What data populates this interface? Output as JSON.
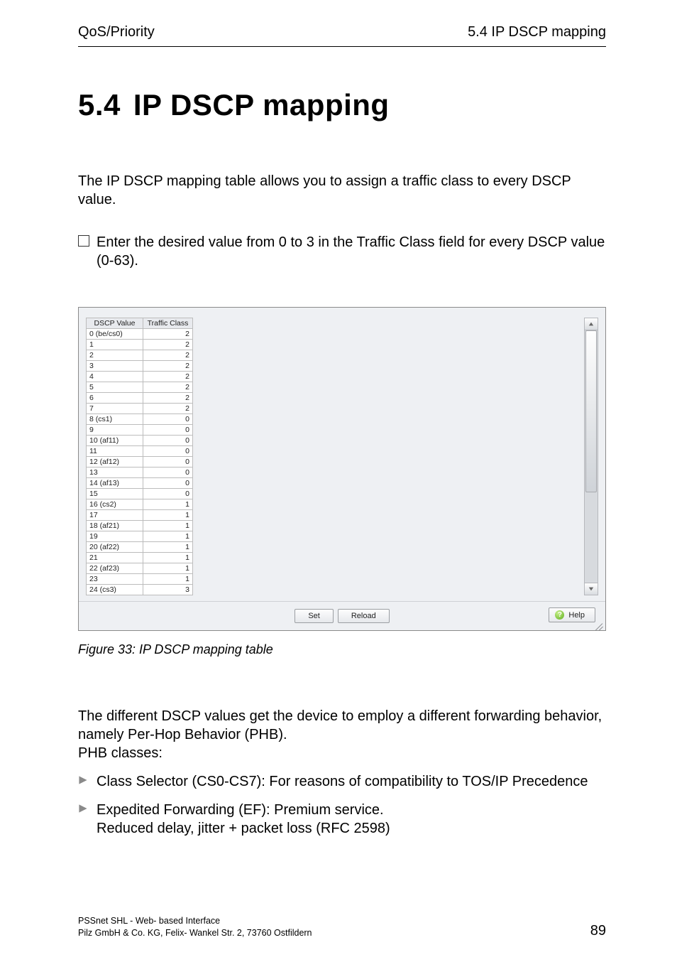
{
  "header": {
    "left": "QoS/Priority",
    "right": "5.4  IP DSCP mapping"
  },
  "title": {
    "number": "5.4",
    "text": "IP DSCP mapping"
  },
  "intro": "The IP DSCP mapping table allows you to assign a traffic class to every DSCP value.",
  "task": "Enter the desired value from 0 to 3 in the Traffic Class field for every DSCP value (0-63).",
  "figure": {
    "columns": {
      "dscp": "DSCP Value",
      "tc": "Traffic Class"
    },
    "rows": [
      {
        "dscp": "0 (be/cs0)",
        "tc": 2
      },
      {
        "dscp": "1",
        "tc": 2
      },
      {
        "dscp": "2",
        "tc": 2
      },
      {
        "dscp": "3",
        "tc": 2
      },
      {
        "dscp": "4",
        "tc": 2
      },
      {
        "dscp": "5",
        "tc": 2
      },
      {
        "dscp": "6",
        "tc": 2
      },
      {
        "dscp": "7",
        "tc": 2
      },
      {
        "dscp": "8 (cs1)",
        "tc": 0
      },
      {
        "dscp": "9",
        "tc": 0
      },
      {
        "dscp": "10 (af11)",
        "tc": 0
      },
      {
        "dscp": "11",
        "tc": 0
      },
      {
        "dscp": "12 (af12)",
        "tc": 0
      },
      {
        "dscp": "13",
        "tc": 0
      },
      {
        "dscp": "14 (af13)",
        "tc": 0
      },
      {
        "dscp": "15",
        "tc": 0
      },
      {
        "dscp": "16 (cs2)",
        "tc": 1
      },
      {
        "dscp": "17",
        "tc": 1
      },
      {
        "dscp": "18 (af21)",
        "tc": 1
      },
      {
        "dscp": "19",
        "tc": 1
      },
      {
        "dscp": "20 (af22)",
        "tc": 1
      },
      {
        "dscp": "21",
        "tc": 1
      },
      {
        "dscp": "22 (af23)",
        "tc": 1
      },
      {
        "dscp": "23",
        "tc": 1
      },
      {
        "dscp": "24 (cs3)",
        "tc": 3
      }
    ],
    "buttons": {
      "set": "Set",
      "reload": "Reload",
      "help": "Help"
    }
  },
  "caption": "Figure 33: IP DSCP mapping table",
  "post_paragraph": "The different DSCP values get the device to employ a different forwarding behavior, namely Per-Hop Behavior (PHB).\nPHB classes:",
  "bullets": [
    "Class Selector (CS0-CS7): For reasons of compatibility to TOS/IP Precedence",
    "Expedited Forwarding (EF): Premium service.\nReduced delay, jitter + packet loss (RFC 2598)"
  ],
  "footer": {
    "line1": "PSSnet SHL - Web- based Interface",
    "line2": "Pilz GmbH & Co. KG, Felix- Wankel Str. 2, 73760 Ostfildern",
    "page": "89"
  },
  "chart_data": {
    "type": "table",
    "title": "IP DSCP mapping table",
    "columns": [
      "DSCP Value",
      "Traffic Class"
    ],
    "rows": [
      [
        "0 (be/cs0)",
        2
      ],
      [
        "1",
        2
      ],
      [
        "2",
        2
      ],
      [
        "3",
        2
      ],
      [
        "4",
        2
      ],
      [
        "5",
        2
      ],
      [
        "6",
        2
      ],
      [
        "7",
        2
      ],
      [
        "8 (cs1)",
        0
      ],
      [
        "9",
        0
      ],
      [
        "10 (af11)",
        0
      ],
      [
        "11",
        0
      ],
      [
        "12 (af12)",
        0
      ],
      [
        "13",
        0
      ],
      [
        "14 (af13)",
        0
      ],
      [
        "15",
        0
      ],
      [
        "16 (cs2)",
        1
      ],
      [
        "17",
        1
      ],
      [
        "18 (af21)",
        1
      ],
      [
        "19",
        1
      ],
      [
        "20 (af22)",
        1
      ],
      [
        "21",
        1
      ],
      [
        "22 (af23)",
        1
      ],
      [
        "23",
        1
      ],
      [
        "24 (cs3)",
        3
      ]
    ]
  }
}
